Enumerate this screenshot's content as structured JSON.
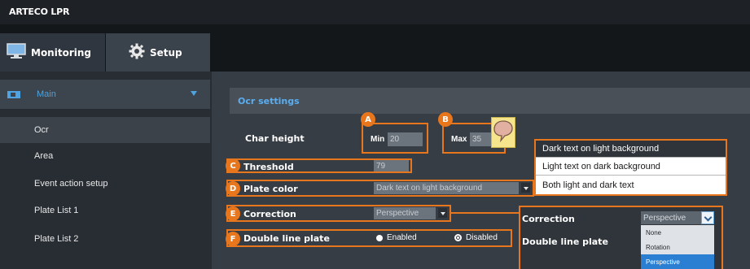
{
  "app": {
    "title": "ARTECO LPR"
  },
  "tabs": [
    {
      "label": "Monitoring",
      "icon": "monitor-icon"
    },
    {
      "label": "Setup",
      "icon": "gear-icon"
    }
  ],
  "sidebar": {
    "group": {
      "label": "Main",
      "icon": "camera-icon",
      "expanded": true
    },
    "items": [
      {
        "label": "Ocr",
        "active": true
      },
      {
        "label": "Area"
      },
      {
        "label": "Event action setup"
      },
      {
        "label": "Plate List 1"
      },
      {
        "label": "Plate List 2"
      }
    ]
  },
  "panel": {
    "header": "Ocr settings",
    "char_height": {
      "label": "Char height",
      "min_label": "Min",
      "min_value": "20",
      "max_label": "Max",
      "max_value": "35"
    },
    "threshold": {
      "label": "Threshold",
      "value": "79"
    },
    "plate_color": {
      "label": "Plate color",
      "value": "Dark text on light background",
      "options": [
        "Dark text on light background",
        "Light text on dark background",
        "Both light and dark text"
      ]
    },
    "correction": {
      "label": "Correction",
      "value": "Perspective"
    },
    "double_line_plate": {
      "label": "Double line plate",
      "enabled_label": "Enabled",
      "disabled_label": "Disabled"
    }
  },
  "badges": [
    "A",
    "B",
    "C",
    "D",
    "E",
    "F"
  ],
  "correction_popup": {
    "correction_label": "Correction",
    "double_line_label": "Double line plate",
    "selected": "Perspective",
    "options": [
      "None",
      "Rotation",
      "Perspective"
    ]
  },
  "colors": {
    "accent": "#e8761c",
    "link_blue": "#5aaef0",
    "selected_blue": "#2b7fd3"
  }
}
